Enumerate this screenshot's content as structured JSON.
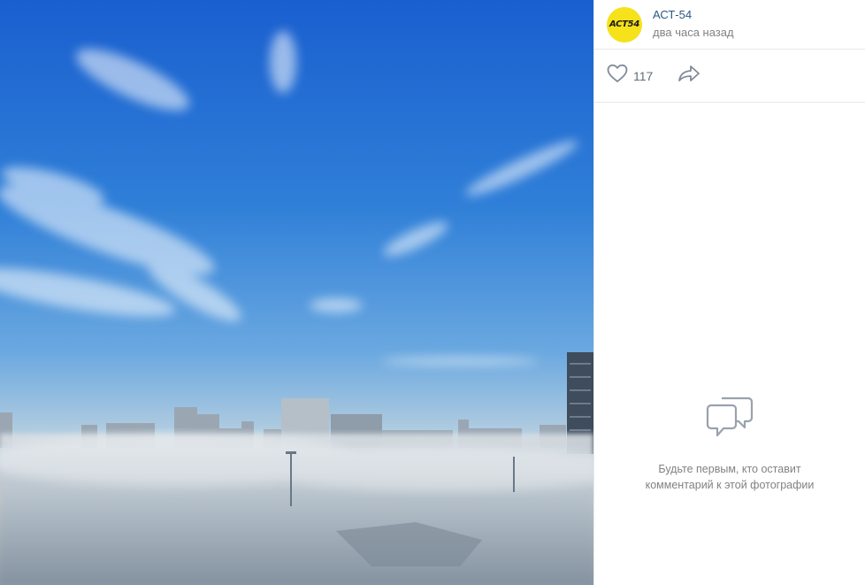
{
  "post": {
    "author": "АСТ-54",
    "avatar_text": "ACT54",
    "time": "два часа назад",
    "likes": "117"
  },
  "comments": {
    "empty_text": "Будьте первым, кто оставит комментарий к этой фотографии"
  },
  "colors": {
    "author_link": "#2a5885",
    "muted_text": "#828282",
    "avatar_bg": "#f5e21a"
  },
  "icons": {
    "like": "heart-icon",
    "share": "share-arrow-icon",
    "empty_comments": "comment-bubble-icon"
  }
}
